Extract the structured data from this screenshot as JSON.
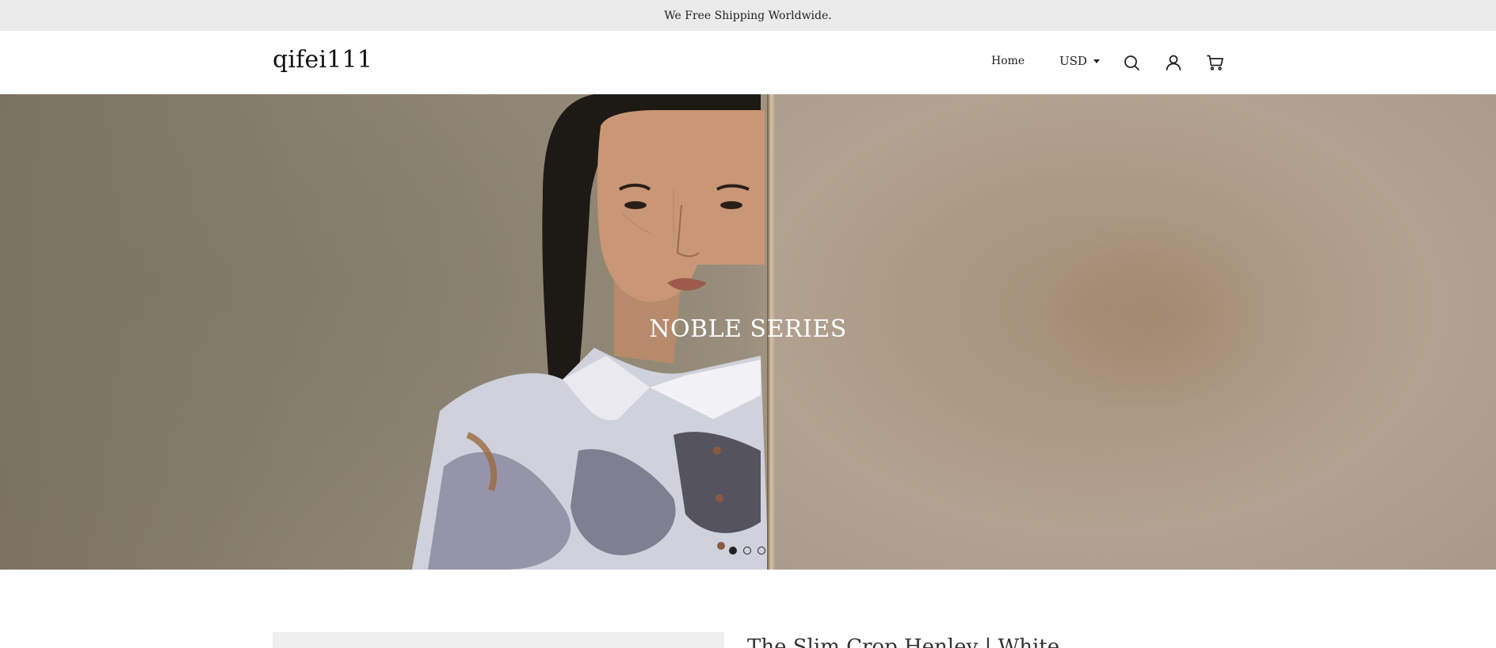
{
  "announcement": {
    "text": "We Free Shipping Worldwide."
  },
  "header": {
    "logo": "qifei111",
    "nav": {
      "home": "Home"
    },
    "currency": {
      "selected": "USD"
    },
    "icons": {
      "search": "search-icon",
      "account": "account-icon",
      "cart": "cart-icon"
    }
  },
  "hero": {
    "title": "NOBLE SERIES",
    "slides": {
      "count": 3,
      "active_index": 0
    }
  },
  "product": {
    "title": "The Slim Crop Henley | White"
  },
  "colors": {
    "announcement_bg": "#ebebeb",
    "text": "#222222",
    "hero_text": "#ffffff"
  }
}
